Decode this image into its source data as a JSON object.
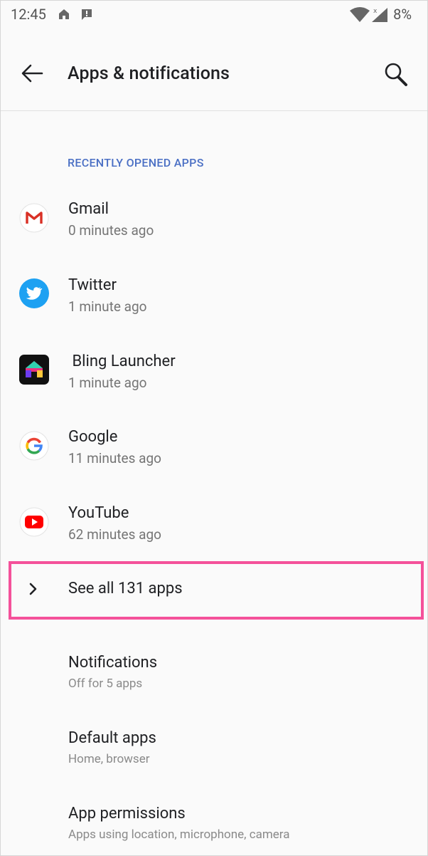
{
  "status_bar": {
    "time": "12:45",
    "battery": "8%"
  },
  "header": {
    "title": "Apps & notifications"
  },
  "recent_apps": {
    "section_title": "RECENTLY OPENED APPS",
    "items": [
      {
        "name": "Gmail",
        "time": "0 minutes ago",
        "icon": "gmail-icon"
      },
      {
        "name": "Twitter",
        "time": "1 minute ago",
        "icon": "twitter-icon"
      },
      {
        "name": " Bling Launcher",
        "time": "1 minute ago",
        "icon": "bling-launcher-icon"
      },
      {
        "name": "Google",
        "time": "11 minutes ago",
        "icon": "google-icon"
      },
      {
        "name": "YouTube",
        "time": "62 minutes ago",
        "icon": "youtube-icon"
      }
    ]
  },
  "see_all": {
    "label": "See all 131 apps"
  },
  "settings": [
    {
      "title": "Notifications",
      "subtitle": "Off for 5 apps"
    },
    {
      "title": "Default apps",
      "subtitle": "Home, browser"
    },
    {
      "title": "App permissions",
      "subtitle": "Apps using location, microphone, camera"
    }
  ],
  "colors": {
    "accent": "#4a6fc4",
    "highlight": "#f4519a"
  }
}
